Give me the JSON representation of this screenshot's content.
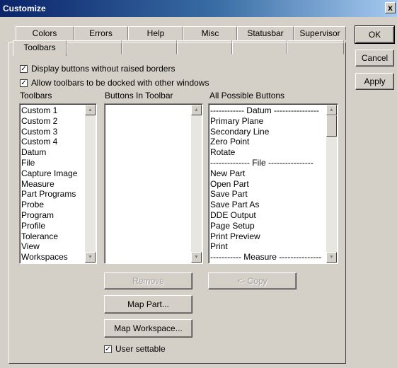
{
  "window": {
    "title": "Customize",
    "close_glyph": "x"
  },
  "tabs_back": [
    "Colors",
    "Errors",
    "Help",
    "Misc",
    "Statusbar",
    "Supervisor"
  ],
  "tab_active": "Toolbars",
  "buttons": {
    "ok": "OK",
    "cancel": "Cancel",
    "apply": "Apply",
    "remove": "Remove",
    "copy": "<- Copy",
    "map_part": "Map Part...",
    "map_workspace": "Map Workspace..."
  },
  "options": {
    "display_no_raised": {
      "label": "Display buttons without raised borders",
      "checked": true
    },
    "allow_docked": {
      "label": "Allow toolbars to be docked with other windows",
      "checked": true
    },
    "user_settable": {
      "label": "User settable",
      "checked": true
    }
  },
  "toolbars": {
    "header": "Toolbars",
    "items": [
      "Custom 1",
      "Custom 2",
      "Custom 3",
      "Custom 4",
      "Datum",
      "File",
      "Capture Image",
      "Measure",
      "Part Programs",
      "Probe",
      "Program",
      "Profile",
      "Tolerance",
      "View",
      "Workspaces"
    ]
  },
  "buttons_in_toolbar": {
    "header": "Buttons In Toolbar",
    "items": []
  },
  "all_buttons": {
    "header": "All Possible Buttons",
    "items": [
      "------------ Datum ----------------",
      "Primary Plane",
      "Secondary Line",
      "Zero Point",
      "Rotate",
      "-------------- File ----------------",
      "New Part",
      "Open Part",
      "Save Part",
      "Save Part As",
      "DDE Output",
      "Page Setup",
      "Print Preview",
      "Print",
      "----------- Measure ---------------"
    ]
  },
  "icons": {
    "check": "check-mark",
    "scroll_up": "up-arrow",
    "scroll_down": "down-arrow"
  }
}
